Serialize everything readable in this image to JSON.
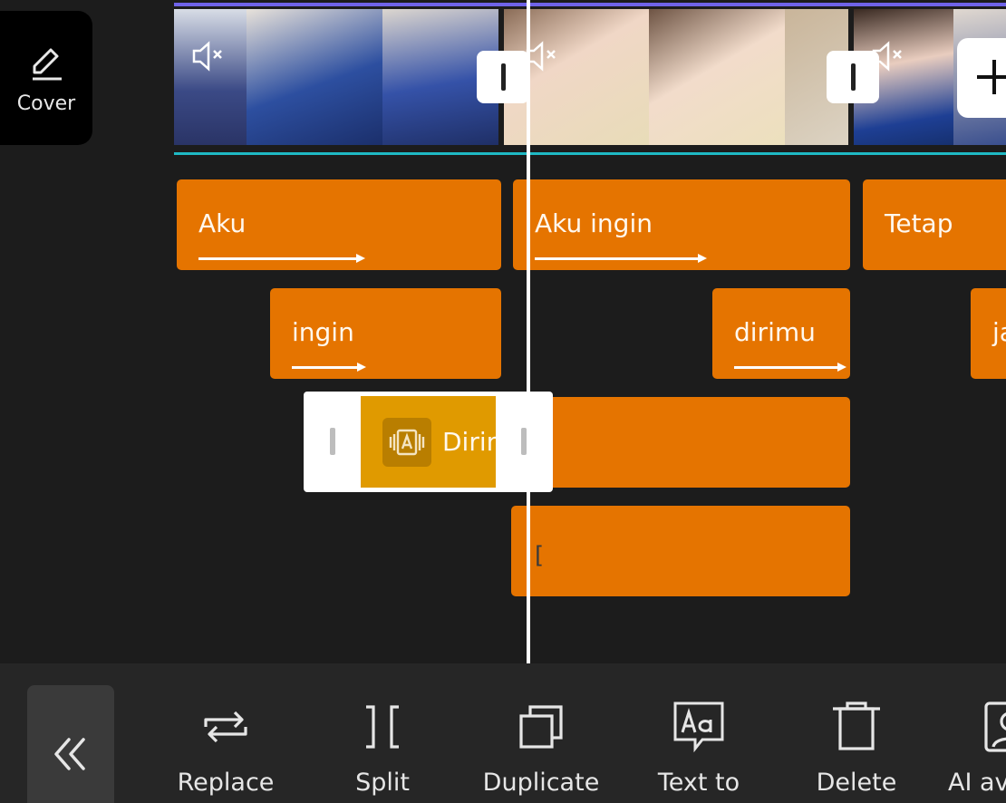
{
  "cover": {
    "label": "Cover",
    "icon": "edit-pencil-icon"
  },
  "video_track": {
    "clips": [
      {
        "name": "clip-1",
        "frame_colors": [
          "#3b4a86",
          "#2d4fa0",
          "#3552a8"
        ],
        "muted": true
      },
      {
        "name": "clip-2",
        "frame_colors": [
          "#c9b59a",
          "#b8a48c",
          "#cdbda6"
        ],
        "muted": true
      },
      {
        "name": "clip-3",
        "frame_colors": [
          "#3a4f8e",
          "#1e3f94"
        ],
        "muted": true
      }
    ],
    "top_line_color": "#6f63e8",
    "bottom_line_color": "#1fb9c4"
  },
  "text_track": {
    "clips": [
      {
        "label": "Aku"
      },
      {
        "label": "Aku ingin"
      },
      {
        "label": "Tetap"
      },
      {
        "label": "ingin"
      },
      {
        "label": "dirimu"
      },
      {
        "label": "ja"
      },
      {
        "label": ""
      },
      {
        "label": ""
      }
    ],
    "selected": {
      "label": "Dirimu",
      "icon": "text-animation-icon"
    },
    "caret": "[",
    "clip_color": "#e57400",
    "selected_color": "#e09a00"
  },
  "toolbar": {
    "back_icon": "double-chevron-left-icon",
    "tools": [
      {
        "label": "Replace",
        "icon": "replace-icon"
      },
      {
        "label": "Split",
        "icon": "split-icon"
      },
      {
        "label": "Duplicate",
        "icon": "duplicate-icon"
      },
      {
        "label": "Text to",
        "icon": "text-to-speech-icon"
      },
      {
        "label": "Delete",
        "icon": "delete-icon"
      },
      {
        "label": "AI av",
        "icon": "ai-avatar-icon"
      }
    ]
  }
}
